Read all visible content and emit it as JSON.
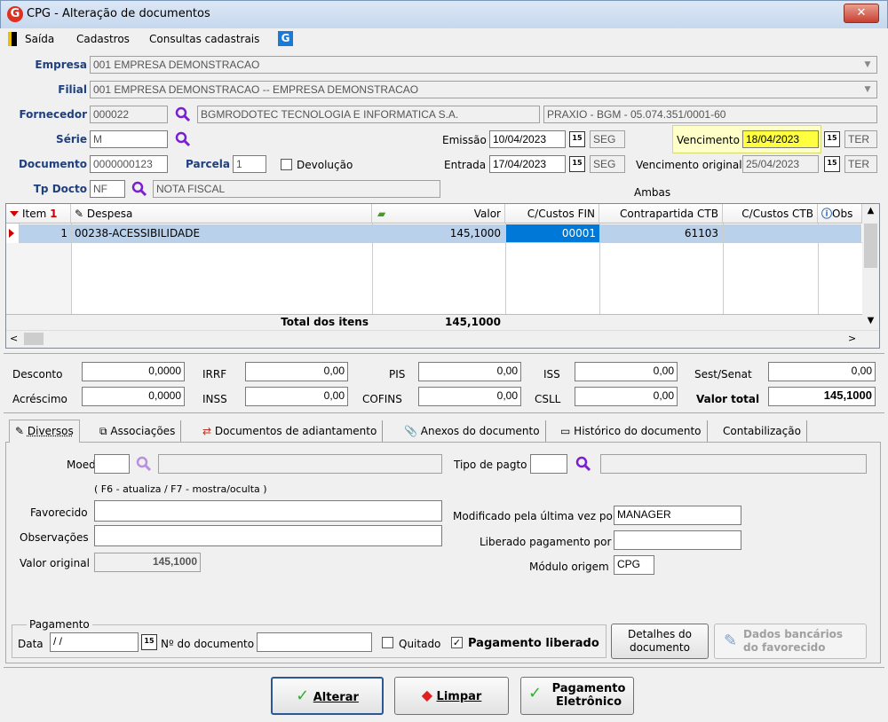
{
  "window": {
    "title": "CPG - Alteração de documentos",
    "close": "✕"
  },
  "menu": {
    "exit": "Saída",
    "registers": "Cadastros",
    "queries": "Consultas cadastrais"
  },
  "header": {
    "company_label": "Empresa",
    "company_value": "001 EMPRESA DEMONSTRACAO",
    "branch_label": "Filial",
    "branch_value": "001 EMPRESA DEMONSTRACAO -- EMPRESA DEMONSTRACAO",
    "supplier_label": "Fornecedor",
    "supplier_code": "000022",
    "supplier_name": "BGMRODOTEC TECNOLOGIA E INFORMATICA S.A.",
    "supplier_extra": "PRAXIO - BGM - 05.074.351/0001-60",
    "series_label": "Série",
    "series_value": "M",
    "issue_label": "Emissão",
    "issue_date": "10/04/2023",
    "issue_day": "SEG",
    "due_label": "Vencimento",
    "due_date": "18/04/2023",
    "due_day": "TER",
    "document_label": "Documento",
    "document_value": "0000000123",
    "installment_label": "Parcela",
    "installment_value": "1",
    "return_label": "Devolução",
    "entry_label": "Entrada",
    "entry_date": "17/04/2023",
    "entry_day": "SEG",
    "orig_due_label": "Vencimento original",
    "orig_due_date": "25/04/2023",
    "orig_due_day": "TER",
    "doctype_label": "Tp Docto",
    "doctype_code": "NF",
    "doctype_name": "NOTA FISCAL",
    "both_label": "Ambas"
  },
  "grid": {
    "columns": [
      "Item",
      "Despesa",
      "Valor",
      "C/Custos FIN",
      "Contrapartida CTB",
      "C/Custos CTB",
      "Obs"
    ],
    "rows": [
      {
        "item": "1",
        "expense": "00238-ACESSIBILIDADE",
        "value": "145,1000",
        "cc_fin": "00001",
        "ctb": "61103",
        "cc_ctb": ""
      }
    ],
    "total_label": "Total dos itens",
    "total_value": "145,1000"
  },
  "totals": {
    "discount_label": "Desconto",
    "discount": "0,0000",
    "irrf_label": "IRRF",
    "irrf": "0,00",
    "pis_label": "PIS",
    "pis": "0,00",
    "iss_label": "ISS",
    "iss": "0,00",
    "sest_label": "Sest/Senat",
    "sest": "0,00",
    "addition_label": "Acréscimo",
    "addition": "0,0000",
    "inss_label": "INSS",
    "inss": "0,00",
    "cofins_label": "COFINS",
    "cofins": "0,00",
    "csll_label": "CSLL",
    "csll": "0,00",
    "total_label": "Valor total",
    "total": "145,1000"
  },
  "tabs": [
    "Diversos",
    "Associações",
    "Documentos de adiantamento",
    "Anexos do documento",
    "Histórico do documento",
    "Contabilização"
  ],
  "diversos": {
    "currency_label": "Moeda",
    "payment_type_label": "Tipo de pagto",
    "hint": "( F6 - atualiza / F7 - mostra/oculta )",
    "payee_label": "Favorecido",
    "notes_label": "Observações",
    "original_value_label": "Valor original",
    "original_value": "145,1000",
    "modified_by_label": "Modificado pela última vez por",
    "modified_by": "MANAGER",
    "released_by_label": "Liberado pagamento por",
    "released_by": "",
    "origin_label": "Módulo origem",
    "origin": "CPG"
  },
  "payment": {
    "group_label": "Pagamento",
    "date_label": "Data",
    "date_value": " / /",
    "docnum_label": "Nº do documento",
    "paid_label": "Quitado",
    "released_label": "Pagamento liberado",
    "details_btn_1": "Detalhes do",
    "details_btn_2": "documento",
    "bank_btn_1": "Dados bancários",
    "bank_btn_2": "do favorecido"
  },
  "buttons": {
    "edit": "Alterar",
    "clear": "Limpar",
    "epay_1": "Pagamento",
    "epay_2": "Eletrônico"
  }
}
